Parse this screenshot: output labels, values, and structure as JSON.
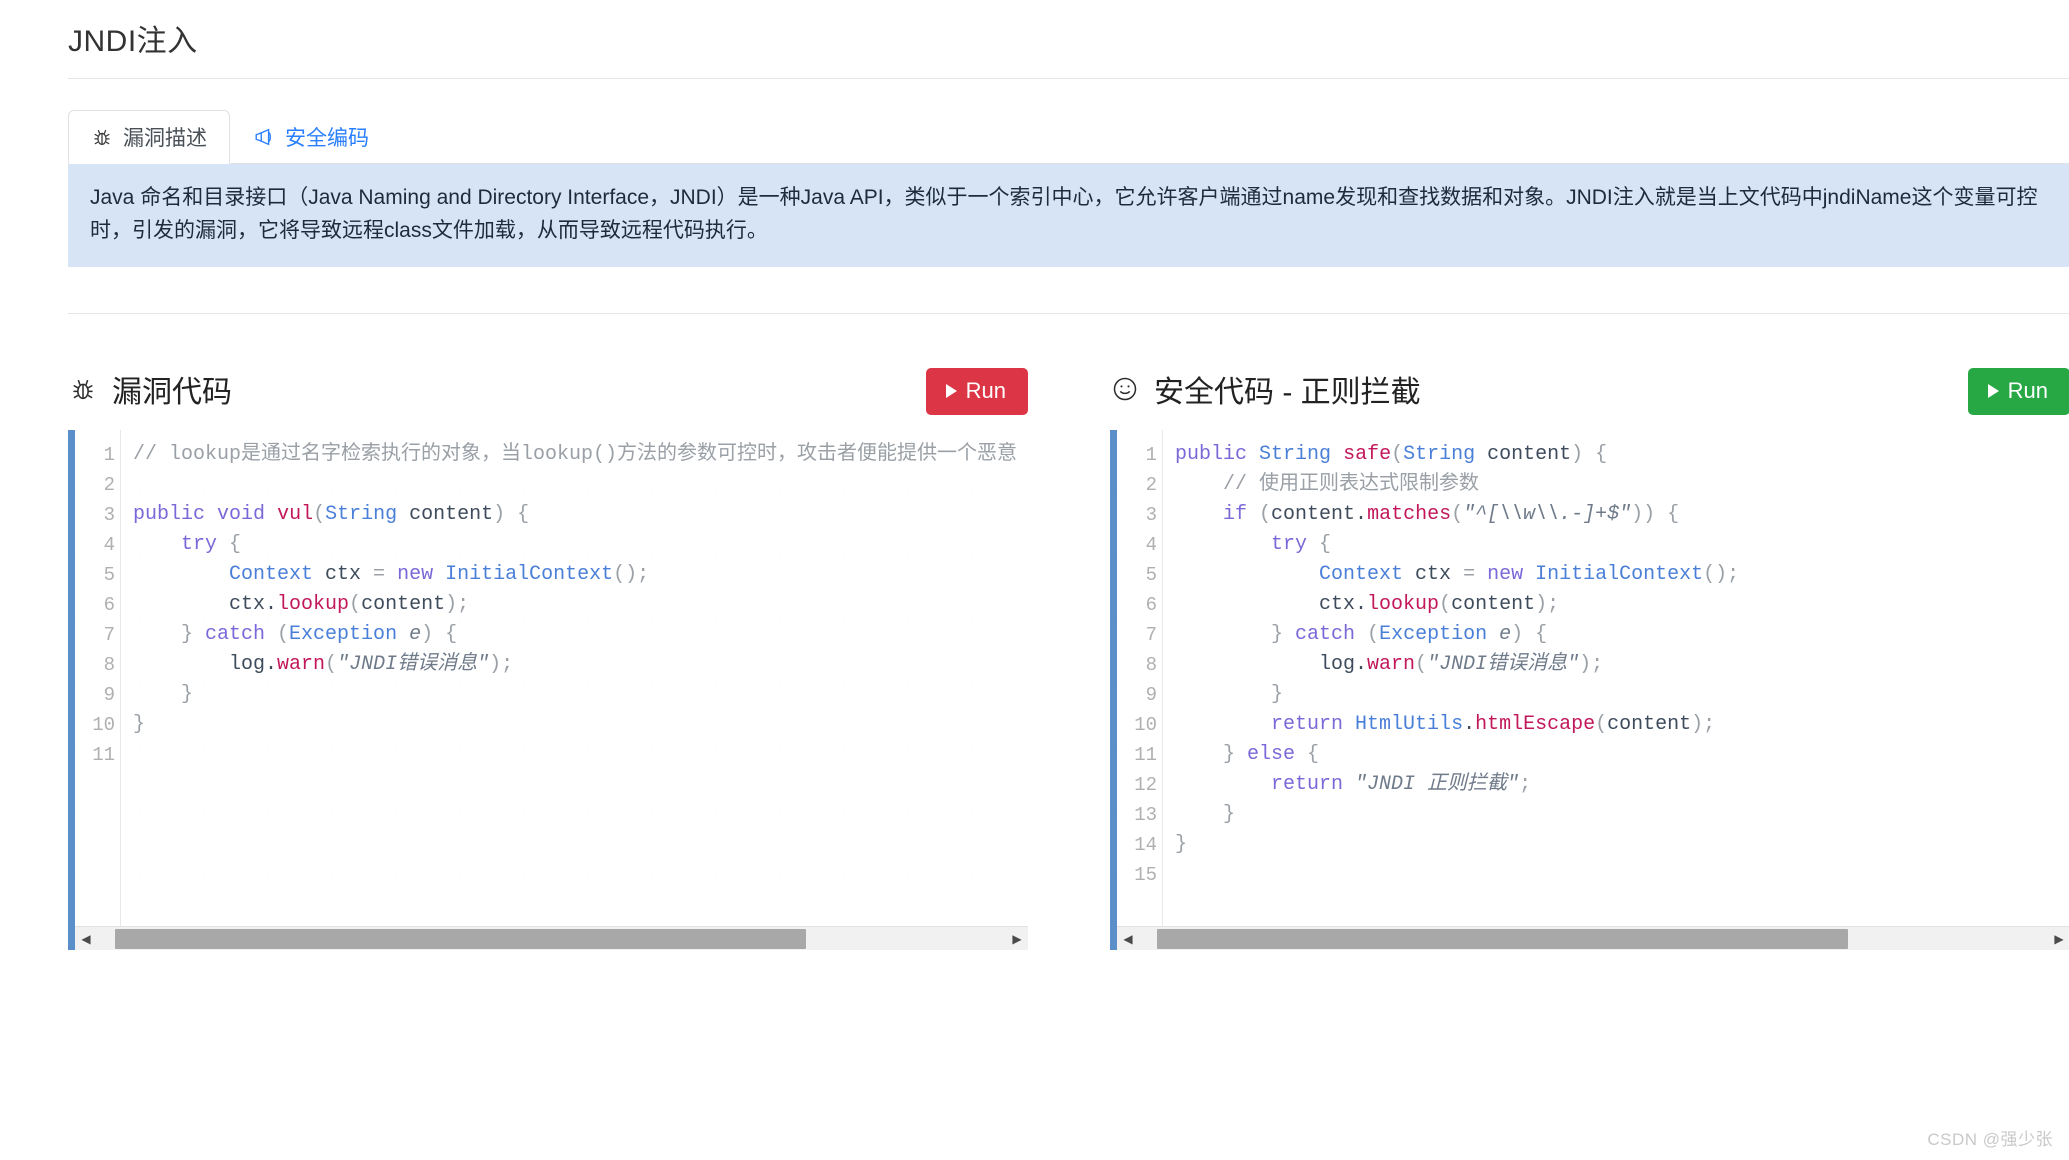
{
  "page": {
    "title": "JNDI注入",
    "watermark": "CSDN @强少张"
  },
  "tabs": [
    {
      "label": "漏洞描述",
      "icon": "bug-icon",
      "active": true
    },
    {
      "label": "安全编码",
      "icon": "megaphone-icon",
      "active": false
    }
  ],
  "alert": {
    "text": "Java 命名和目录接口（Java Naming and Directory Interface，JNDI）是一种Java API，类似于一个索引中心，它允许客户端通过name发现和查找数据和对象。JNDI注入就是当上文代码中jndiName这个变量可控时，引发的漏洞，它将导致远程class文件加载，从而导致远程代码执行。",
    "bg_color": "#d6e4f5"
  },
  "panels": {
    "left": {
      "title": "漏洞代码",
      "icon": "bug-icon",
      "run_label": "Run",
      "run_color": "#dc3545",
      "code_lines": [
        {
          "n": 1,
          "tokens": [
            {
              "t": "cmt",
              "s": "// lookup是通过名字检索执行的对象，当lookup()方法的参数可控时，攻击者便能提供一个恶意"
            }
          ]
        },
        {
          "n": 2,
          "tokens": []
        },
        {
          "n": 3,
          "tokens": [
            {
              "t": "kw",
              "s": "public"
            },
            {
              "t": "pln",
              "s": " "
            },
            {
              "t": "kw",
              "s": "void"
            },
            {
              "t": "pln",
              "s": " "
            },
            {
              "t": "fn",
              "s": "vul"
            },
            {
              "t": "pun",
              "s": "("
            },
            {
              "t": "typ",
              "s": "String"
            },
            {
              "t": "pln",
              "s": " content"
            },
            {
              "t": "pun",
              "s": ") {"
            }
          ]
        },
        {
          "n": 4,
          "tokens": [
            {
              "t": "pln",
              "s": "    "
            },
            {
              "t": "kw",
              "s": "try"
            },
            {
              "t": "pun",
              "s": " {"
            }
          ]
        },
        {
          "n": 5,
          "tokens": [
            {
              "t": "pln",
              "s": "        "
            },
            {
              "t": "typ",
              "s": "Context"
            },
            {
              "t": "pln",
              "s": " ctx "
            },
            {
              "t": "pun",
              "s": "= "
            },
            {
              "t": "kw",
              "s": "new"
            },
            {
              "t": "pln",
              "s": " "
            },
            {
              "t": "typ",
              "s": "InitialContext"
            },
            {
              "t": "pun",
              "s": "();"
            }
          ]
        },
        {
          "n": 6,
          "tokens": [
            {
              "t": "pln",
              "s": "        ctx."
            },
            {
              "t": "fn",
              "s": "lookup"
            },
            {
              "t": "pun",
              "s": "("
            },
            {
              "t": "pln",
              "s": "content"
            },
            {
              "t": "pun",
              "s": ");"
            }
          ]
        },
        {
          "n": 7,
          "tokens": [
            {
              "t": "pun",
              "s": "    } "
            },
            {
              "t": "kw",
              "s": "catch"
            },
            {
              "t": "pun",
              "s": " ("
            },
            {
              "t": "typ",
              "s": "Exception"
            },
            {
              "t": "pln",
              "s": " "
            },
            {
              "t": "str",
              "s": "e"
            },
            {
              "t": "pun",
              "s": ") {"
            }
          ]
        },
        {
          "n": 8,
          "tokens": [
            {
              "t": "pln",
              "s": "        log."
            },
            {
              "t": "fn",
              "s": "warn"
            },
            {
              "t": "pun",
              "s": "("
            },
            {
              "t": "str",
              "s": "\"JNDI错误消息\""
            },
            {
              "t": "pun",
              "s": ");"
            }
          ]
        },
        {
          "n": 9,
          "tokens": [
            {
              "t": "pun",
              "s": "    }"
            }
          ]
        },
        {
          "n": 10,
          "tokens": [
            {
              "t": "pun",
              "s": "}"
            }
          ]
        },
        {
          "n": 11,
          "tokens": []
        }
      ],
      "scrollbar": {
        "thumb_left_pct": 2,
        "thumb_width_pct": 76
      }
    },
    "right": {
      "title": "安全代码 - 正则拦截",
      "icon": "smiley-icon",
      "run_label": "Run",
      "run_color": "#28a745",
      "code_lines": [
        {
          "n": 1,
          "tokens": [
            {
              "t": "kw",
              "s": "public"
            },
            {
              "t": "pln",
              "s": " "
            },
            {
              "t": "typ",
              "s": "String"
            },
            {
              "t": "pln",
              "s": " "
            },
            {
              "t": "fn",
              "s": "safe"
            },
            {
              "t": "pun",
              "s": "("
            },
            {
              "t": "typ",
              "s": "String"
            },
            {
              "t": "pln",
              "s": " content"
            },
            {
              "t": "pun",
              "s": ") {"
            }
          ]
        },
        {
          "n": 2,
          "tokens": [
            {
              "t": "pln",
              "s": "    "
            },
            {
              "t": "cmt",
              "s": "// 使用正则表达式限制参数"
            }
          ]
        },
        {
          "n": 3,
          "tokens": [
            {
              "t": "pln",
              "s": "    "
            },
            {
              "t": "kw",
              "s": "if"
            },
            {
              "t": "pun",
              "s": " ("
            },
            {
              "t": "pln",
              "s": "content."
            },
            {
              "t": "fn",
              "s": "matches"
            },
            {
              "t": "pun",
              "s": "("
            },
            {
              "t": "str",
              "s": "\"^[\\\\w\\\\.-]+$\""
            },
            {
              "t": "pun",
              "s": ")) {"
            }
          ]
        },
        {
          "n": 4,
          "tokens": [
            {
              "t": "pln",
              "s": "        "
            },
            {
              "t": "kw",
              "s": "try"
            },
            {
              "t": "pun",
              "s": " {"
            }
          ]
        },
        {
          "n": 5,
          "tokens": [
            {
              "t": "pln",
              "s": "            "
            },
            {
              "t": "typ",
              "s": "Context"
            },
            {
              "t": "pln",
              "s": " ctx "
            },
            {
              "t": "pun",
              "s": "= "
            },
            {
              "t": "kw",
              "s": "new"
            },
            {
              "t": "pln",
              "s": " "
            },
            {
              "t": "typ",
              "s": "InitialContext"
            },
            {
              "t": "pun",
              "s": "();"
            }
          ]
        },
        {
          "n": 6,
          "tokens": [
            {
              "t": "pln",
              "s": "            ctx."
            },
            {
              "t": "fn",
              "s": "lookup"
            },
            {
              "t": "pun",
              "s": "("
            },
            {
              "t": "pln",
              "s": "content"
            },
            {
              "t": "pun",
              "s": ");"
            }
          ]
        },
        {
          "n": 7,
          "tokens": [
            {
              "t": "pun",
              "s": "        } "
            },
            {
              "t": "kw",
              "s": "catch"
            },
            {
              "t": "pun",
              "s": " ("
            },
            {
              "t": "typ",
              "s": "Exception"
            },
            {
              "t": "pln",
              "s": " "
            },
            {
              "t": "str",
              "s": "e"
            },
            {
              "t": "pun",
              "s": ") {"
            }
          ]
        },
        {
          "n": 8,
          "tokens": [
            {
              "t": "pln",
              "s": "            log."
            },
            {
              "t": "fn",
              "s": "warn"
            },
            {
              "t": "pun",
              "s": "("
            },
            {
              "t": "str",
              "s": "\"JNDI错误消息\""
            },
            {
              "t": "pun",
              "s": ");"
            }
          ]
        },
        {
          "n": 9,
          "tokens": [
            {
              "t": "pun",
              "s": "        }"
            }
          ]
        },
        {
          "n": 10,
          "tokens": [
            {
              "t": "pln",
              "s": "        "
            },
            {
              "t": "kw",
              "s": "return"
            },
            {
              "t": "pln",
              "s": " "
            },
            {
              "t": "typ",
              "s": "HtmlUtils"
            },
            {
              "t": "pln",
              "s": "."
            },
            {
              "t": "fn",
              "s": "htmlEscape"
            },
            {
              "t": "pun",
              "s": "("
            },
            {
              "t": "pln",
              "s": "content"
            },
            {
              "t": "pun",
              "s": ");"
            }
          ]
        },
        {
          "n": 11,
          "tokens": [
            {
              "t": "pun",
              "s": "    } "
            },
            {
              "t": "kw",
              "s": "else"
            },
            {
              "t": "pun",
              "s": " {"
            }
          ]
        },
        {
          "n": 12,
          "tokens": [
            {
              "t": "pln",
              "s": "        "
            },
            {
              "t": "kw",
              "s": "return"
            },
            {
              "t": "pln",
              "s": " "
            },
            {
              "t": "str",
              "s": "\"JNDI 正则拦截\""
            },
            {
              "t": "pun",
              "s": ";"
            }
          ]
        },
        {
          "n": 13,
          "tokens": [
            {
              "t": "pun",
              "s": "    }"
            }
          ]
        },
        {
          "n": 14,
          "tokens": [
            {
              "t": "pun",
              "s": "}"
            }
          ]
        },
        {
          "n": 15,
          "tokens": []
        }
      ],
      "scrollbar": {
        "thumb_left_pct": 2,
        "thumb_width_pct": 76
      }
    }
  },
  "scroll_arrows": {
    "left": "◀",
    "right": "▶"
  }
}
